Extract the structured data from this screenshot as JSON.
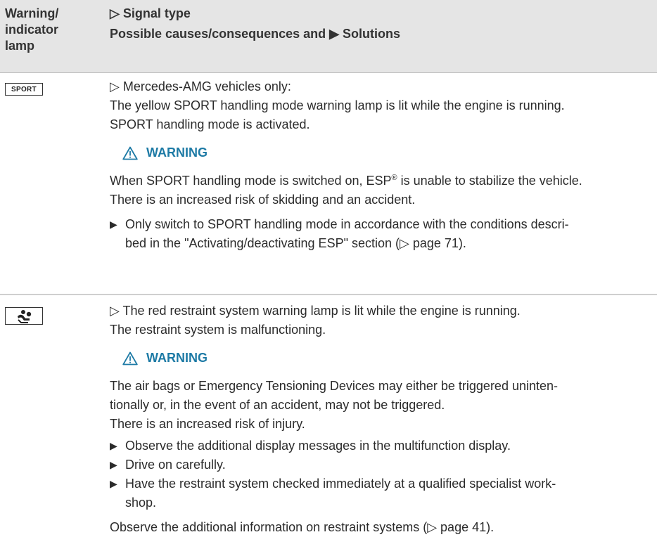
{
  "header": {
    "col1_line1": "Warning/",
    "col1_line2": "indicator",
    "col1_line3": "lamp",
    "signal_type": "▷ Signal type",
    "causes": "Possible causes/consequences and ▶ Solutions"
  },
  "rows": [
    {
      "lamp_text": "SPORT",
      "lines": [
        "▷ Mercedes-AMG vehicles only:",
        "The yellow SPORT handling mode warning lamp is lit while the engine is running.",
        "SPORT handling mode is activated."
      ],
      "warning_label": "WARNING",
      "warn_line1_a": "When SPORT handling mode is switched on, ESP",
      "warn_line1_sup": "®",
      "warn_line1_b": " is unable to stabilize the vehicle.",
      "warn_line2": "There is an increased risk of skidding and an accident.",
      "bullets": [
        [
          "Only switch to SPORT handling mode in accordance with the conditions descri-",
          "bed in the \"Activating/deactivating ESP\" section (▷ page 71)."
        ]
      ]
    },
    {
      "lamp_icon": "restraint-system-icon",
      "lines": [
        "▷ The red restraint system warning lamp is lit while the engine is running.",
        "The restraint system is malfunctioning."
      ],
      "warning_label": "WARNING",
      "warn_lines": [
        "The air bags or Emergency Tensioning Devices may either be triggered uninten-",
        "tionally or, in the event of an accident, may not be triggered.",
        "There is an increased risk of injury."
      ],
      "bullets": [
        [
          "Observe the additional display messages in the multifunction display."
        ],
        [
          "Drive on carefully."
        ],
        [
          "Have the restraint system checked immediately at a qualified specialist work-",
          "shop."
        ]
      ],
      "footer": "Observe the additional information on restraint systems (▷ page 41)."
    }
  ],
  "colors": {
    "header_bg": "#e5e5e5",
    "warning_accent": "#1d7aa5",
    "text": "#2b2b2b"
  }
}
